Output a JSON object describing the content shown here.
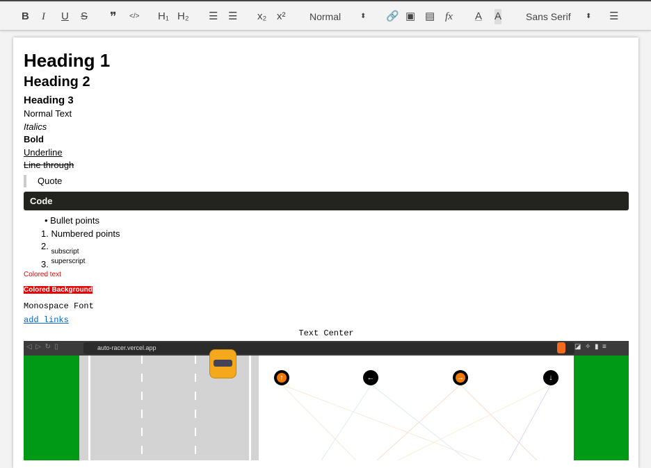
{
  "toolbar": {
    "bold": "B",
    "italic": "I",
    "underline": "U",
    "strike": "S",
    "quote": "❞",
    "code": "</>",
    "h1": "H₁",
    "h2": "H₂",
    "ol": "☰",
    "ul": "☰",
    "sub": "x₂",
    "sup": "x²",
    "header_select": "Normal",
    "link": "🔗",
    "image": "▣",
    "video": "▤",
    "formula": "fx",
    "color": "A",
    "background": "A",
    "font_select": "Sans Serif",
    "align": "☰"
  },
  "content": {
    "heading1": "Heading 1",
    "heading2": "Heading 2",
    "heading3": "Heading 3",
    "normal": "Normal Text",
    "italics": "Italics",
    "bold": "Bold",
    "underline": "Underline",
    "strike": "Line through",
    "quote": "Quote",
    "code": "Code",
    "bullet": "Bullet points",
    "numbered": [
      {
        "n": "1.",
        "text": "Numbered points"
      },
      {
        "n": "2.",
        "text": "subscript"
      },
      {
        "n": "3.",
        "text": "superscript"
      }
    ],
    "colored_text": "Colored text",
    "colored_text_color": "#e60000",
    "colored_bg": "Colored Background",
    "colored_bg_color": "#e60000",
    "monospace": "Monospace Font",
    "link": "add links",
    "center": "Text Center"
  },
  "embedded": {
    "url": "auto-racer.vercel.app",
    "nodes": [
      "↑",
      "←",
      "→",
      "↓"
    ]
  }
}
